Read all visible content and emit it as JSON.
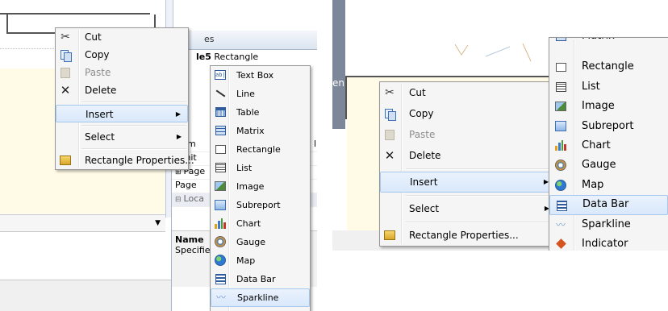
{
  "colors": {
    "menu_bg": "#f5f5f5",
    "menu_border": "#979797",
    "highlight_bg": "#d9e8fb",
    "highlight_border": "#a6c8ec",
    "disabled_text": "#8d8d8d",
    "report_fill": "#fffbe6"
  },
  "left_view": {
    "properties": {
      "title_fragment": "es",
      "selected_object_name": "le5",
      "selected_object_type": "Rectangle",
      "rows": [
        {
          "label": "Nam",
          "suffix": "l"
        },
        {
          "label": "Omit"
        },
        {
          "label": "Page",
          "expander": "⊞"
        },
        {
          "label": "Page"
        },
        {
          "label": "Loca",
          "expander": "⊟",
          "group": true
        }
      ],
      "help_name_label": "Name",
      "help_text_fragment": "Specifie"
    },
    "context_menu": {
      "items": [
        {
          "label": "Cut",
          "icon": "scissors-icon"
        },
        {
          "label": "Copy",
          "icon": "copy-icon"
        },
        {
          "label": "Paste",
          "icon": "paste-icon",
          "disabled": true
        },
        {
          "label": "Delete",
          "icon": "delete-icon"
        },
        {
          "label": "Insert",
          "submenu": true,
          "highlighted": true
        },
        {
          "label": "Select",
          "submenu": true
        },
        {
          "label": "Rectangle Properties...",
          "icon": "properties-icon"
        }
      ]
    },
    "insert_submenu": {
      "items": [
        {
          "label": "Text Box",
          "icon": "textbox-icon"
        },
        {
          "label": "Line",
          "icon": "line-icon"
        },
        {
          "label": "Table",
          "icon": "table-icon"
        },
        {
          "label": "Matrix",
          "icon": "matrix-icon"
        },
        {
          "label": "Rectangle",
          "icon": "rectangle-icon"
        },
        {
          "label": "List",
          "icon": "list-icon"
        },
        {
          "label": "Image",
          "icon": "image-icon"
        },
        {
          "label": "Subreport",
          "icon": "subreport-icon"
        },
        {
          "label": "Chart",
          "icon": "chart-icon"
        },
        {
          "label": "Gauge",
          "icon": "gauge-icon"
        },
        {
          "label": "Map",
          "icon": "map-icon"
        },
        {
          "label": "Data Bar",
          "icon": "databar-icon"
        },
        {
          "label": "Sparkline",
          "icon": "sparkline-icon",
          "highlighted": true
        },
        {
          "label": "Indicator",
          "icon": "indicator-icon"
        }
      ]
    }
  },
  "right_view": {
    "background_fragment": "en",
    "context_menu": {
      "items": [
        {
          "label": "Cut",
          "icon": "scissors-icon"
        },
        {
          "label": "Copy",
          "icon": "copy-icon"
        },
        {
          "label": "Paste",
          "icon": "paste-icon",
          "disabled": true
        },
        {
          "label": "Delete",
          "icon": "delete-icon"
        },
        {
          "label": "Insert",
          "submenu": true,
          "highlighted": true
        },
        {
          "label": "Select",
          "submenu": true
        },
        {
          "label": "Rectangle Properties...",
          "icon": "properties-icon"
        }
      ]
    },
    "insert_submenu": {
      "items": [
        {
          "label": "Matrix",
          "icon": "matrix-icon",
          "clipped": true
        },
        {
          "label": "Rectangle",
          "icon": "rectangle-icon"
        },
        {
          "label": "List",
          "icon": "list-icon"
        },
        {
          "label": "Image",
          "icon": "image-icon"
        },
        {
          "label": "Subreport",
          "icon": "subreport-icon"
        },
        {
          "label": "Chart",
          "icon": "chart-icon"
        },
        {
          "label": "Gauge",
          "icon": "gauge-icon"
        },
        {
          "label": "Map",
          "icon": "map-icon"
        },
        {
          "label": "Data Bar",
          "icon": "databar-icon",
          "highlighted": true
        },
        {
          "label": "Sparkline",
          "icon": "sparkline-icon"
        },
        {
          "label": "Indicator",
          "icon": "indicator-icon"
        }
      ]
    }
  }
}
